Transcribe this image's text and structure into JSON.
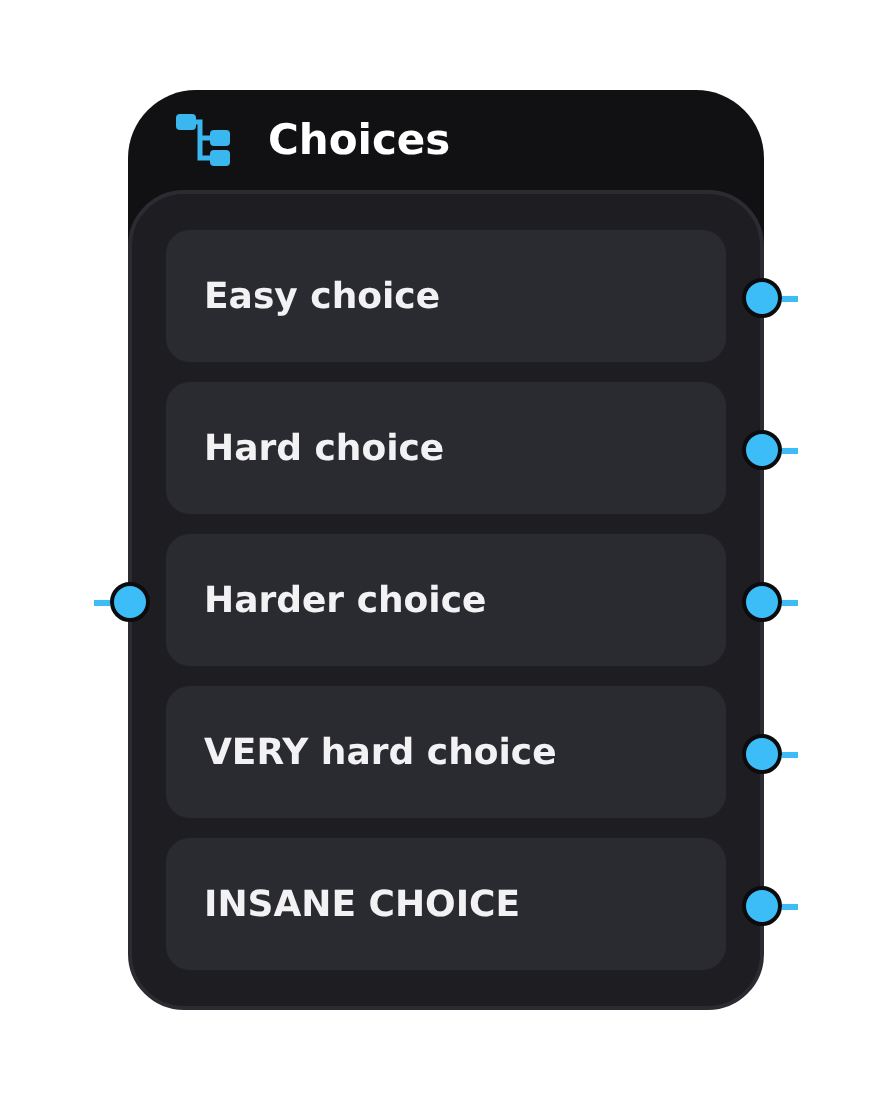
{
  "node": {
    "title": "Choices",
    "choices": [
      {
        "label": "Easy choice",
        "input_port": false,
        "output_port": true
      },
      {
        "label": "Hard choice",
        "input_port": false,
        "output_port": true
      },
      {
        "label": "Harder choice",
        "input_port": true,
        "output_port": true
      },
      {
        "label": "VERY hard choice",
        "input_port": false,
        "output_port": true
      },
      {
        "label": "INSANE CHOICE",
        "input_port": false,
        "output_port": true
      }
    ]
  }
}
